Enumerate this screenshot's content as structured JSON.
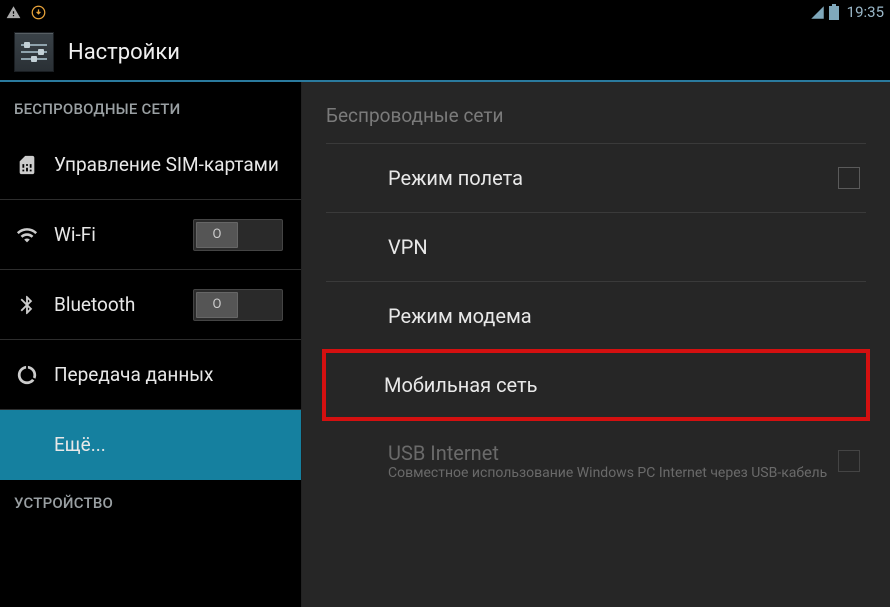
{
  "statusbar": {
    "time": "19:35"
  },
  "header": {
    "title": "Настройки"
  },
  "sidebar": {
    "section_wireless": "БЕСПРОВОДНЫЕ СЕТИ",
    "section_device": "УСТРОЙСТВО",
    "items": {
      "sim": "Управление SIM-картами",
      "wifi": "Wi-Fi",
      "bluetooth": "Bluetooth",
      "data": "Передача данных",
      "more": "Ещё..."
    },
    "toggle_off": "O"
  },
  "content": {
    "header": "Беспроводные сети",
    "items": {
      "airplane": "Режим полета",
      "vpn": "VPN",
      "tethering": "Режим модема",
      "mobile": "Мобильная сеть",
      "usb_title": "USB Internet",
      "usb_sub": "Совместное использование Windows PC Internet через USB-кабель"
    }
  }
}
